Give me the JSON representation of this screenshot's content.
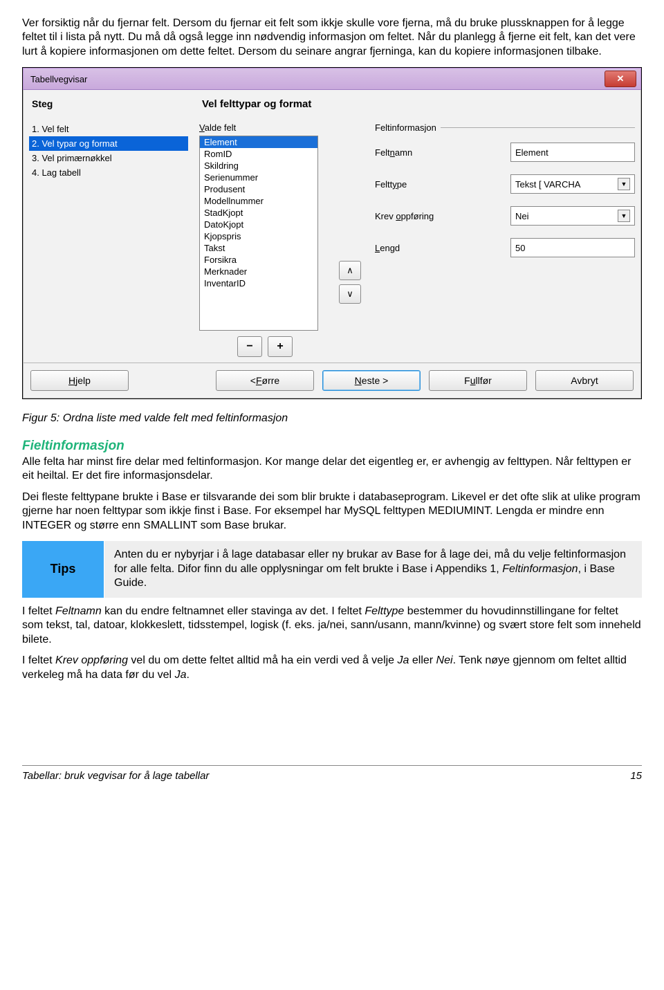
{
  "intro_para": "Ver forsiktig når du fjernar felt. Dersom du fjernar eit felt som ikkje skulle vore fjerna, må du bruke plussknappen for å legge feltet til i lista på nytt. Du må då også legge inn nødvendig informasjon om feltet. Når du planlegg å fjerne eit felt, kan det vere lurt å kopiere informasjonen om dette feltet. Dersom du seinare angrar fjerninga, kan du kopiere informasjonen tilbake.",
  "dialog": {
    "title": "Tabellvegvisar",
    "steps_heading": "Steg",
    "steps": [
      "1. Vel felt",
      "2. Vel typar og format",
      "3. Vel primærnøkkel",
      "4. Lag tabell"
    ],
    "main_heading": "Vel felttypar og format",
    "valde_label": "Valde felt",
    "fields": [
      "Element",
      "RomID",
      "Skildring",
      "Serienummer",
      "Produsent",
      "Modellnummer",
      "StadKjopt",
      "DatoKjopt",
      "Kjopspris",
      "Takst",
      "Forsikra",
      "Merknader",
      "InventarID"
    ],
    "group_title": "Feltinformasjon",
    "form": {
      "feltnamn_label": "Feltnamn",
      "feltnamn_value": "Element",
      "felttype_label": "Felttype",
      "felttype_value": "Tekst [ VARCHA",
      "krev_label": "Krev oppføring",
      "krev_value": "Nei",
      "lengd_label": "Lengd",
      "lengd_value": "50"
    },
    "buttons": {
      "help": "Hjelp",
      "prev": "< Førre",
      "next": "Neste >",
      "finish": "Fullfør",
      "cancel": "Avbryt"
    }
  },
  "figure_caption": "Figur 5: Ordna liste med valde felt med feltinformasjon",
  "section_heading": "Fieltinformasjon",
  "para1": "Alle felta har minst fire delar med feltinformasjon. Kor mange delar det eigentleg er, er avhengig av felttypen. Når felttypen er eit heiltal. Er det fire informasjonsdelar.",
  "para2": "Dei fleste felttypane brukte i Base er tilsvarande dei som blir brukte i databaseprogram. Likevel er det ofte slik at ulike program gjerne har noen felttypar som ikkje finst i Base. For eksempel har MySQL felttypen MEDIUMINT. Lengda er mindre enn INTEGER og større enn SMALLINT som Base brukar.",
  "tips_label": "Tips",
  "tips_body_a": "Anten du er nybyrjar i å lage databasar eller ny brukar av Base for å lage dei, må du velje feltinformasjon for alle felta. Difor finn du alle opplysningar om felt brukte i Base i Appendiks 1, ",
  "tips_body_b": "Feltinformasjon",
  "tips_body_c": ", i Base Guide.",
  "para3_a": "I feltet ",
  "para3_b": "Feltnamn",
  "para3_c": " kan du endre feltnamnet eller stavinga av det. I feltet ",
  "para3_d": "Felttype",
  "para3_e": " bestemmer du hovudinnstillingane for feltet som tekst, tal, datoar, klokkeslett, tidsstempel, logisk (f. eks. ja/nei, sann/usann, mann/kvinne) og svært store felt som inneheld bilete.",
  "para4_a": "I feltet ",
  "para4_b": "Krev oppføring",
  "para4_c": " vel du om dette feltet alltid må ha ein verdi ved å velje ",
  "para4_d": "Ja",
  "para4_e": " eller ",
  "para4_f": "Nei",
  "para4_g": ". Tenk nøye gjennom om feltet alltid verkeleg må ha data før du vel ",
  "para4_h": "Ja",
  "para4_i": ".",
  "footer_title": "Tabellar: bruk vegvisar for å lage tabellar",
  "footer_page": "15"
}
